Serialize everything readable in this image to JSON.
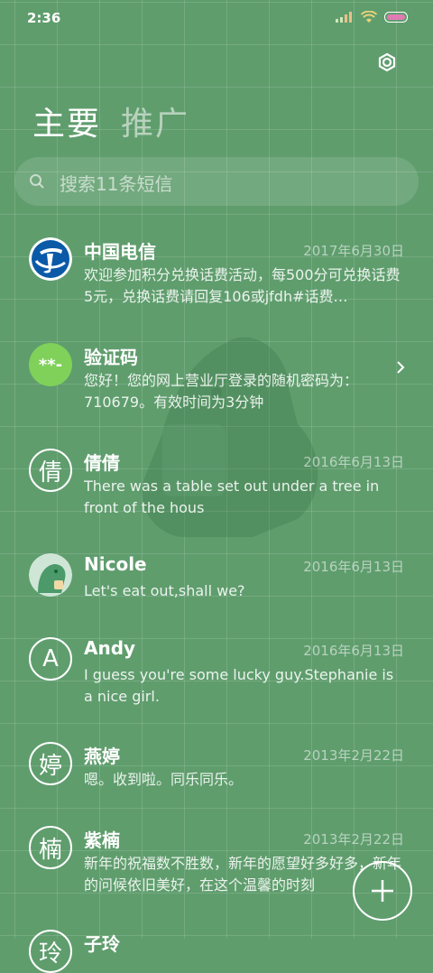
{
  "status": {
    "time": "2:36"
  },
  "tabs": [
    {
      "label": "主要"
    },
    {
      "label": "推广"
    }
  ],
  "search": {
    "placeholder": "搜索11条短信"
  },
  "conversations": [
    {
      "name": "中国电信",
      "date": "2017年6月30日",
      "preview": "欢迎参加积分兑换话费活动，每500分可兑换话费5元，兑换话费请回复106或jfdh#话费…",
      "avatar": "telecom-logo"
    },
    {
      "name": "验证码",
      "date": "",
      "preview": "您好！您的网上营业厅登录的随机密码为：710679。有效时间为3分钟",
      "avatar_text": "**-"
    },
    {
      "name": "倩倩",
      "date": "2016年6月13日",
      "preview": "There was a table set out under a tree in front of the hous",
      "avatar_text": "倩"
    },
    {
      "name": "Nicole",
      "date": "2016年6月13日",
      "preview": "Let's eat out,shall we?",
      "avatar": "dino-photo"
    },
    {
      "name": "Andy",
      "date": "2016年6月13日",
      "preview": "I guess you're some lucky guy.Stephanie is a nice girl.",
      "avatar_text": "A"
    },
    {
      "name": "燕婷",
      "date": "2013年2月22日",
      "preview": "嗯。收到啦。同乐同乐。",
      "avatar_text": "婷"
    },
    {
      "name": "紫楠",
      "date": "2013年2月22日",
      "preview": "新年的祝福数不胜数，新年的愿望好多好多，新年的问候依旧美好，在这个温馨的时刻",
      "avatar_text": "楠"
    },
    {
      "name": "子玲",
      "date": "",
      "preview": "",
      "avatar_text": "玲"
    }
  ],
  "colors": {
    "background": "#5f9d6d",
    "accent_green": "#7fd15a",
    "telecom_blue": "#0a5aa8"
  }
}
